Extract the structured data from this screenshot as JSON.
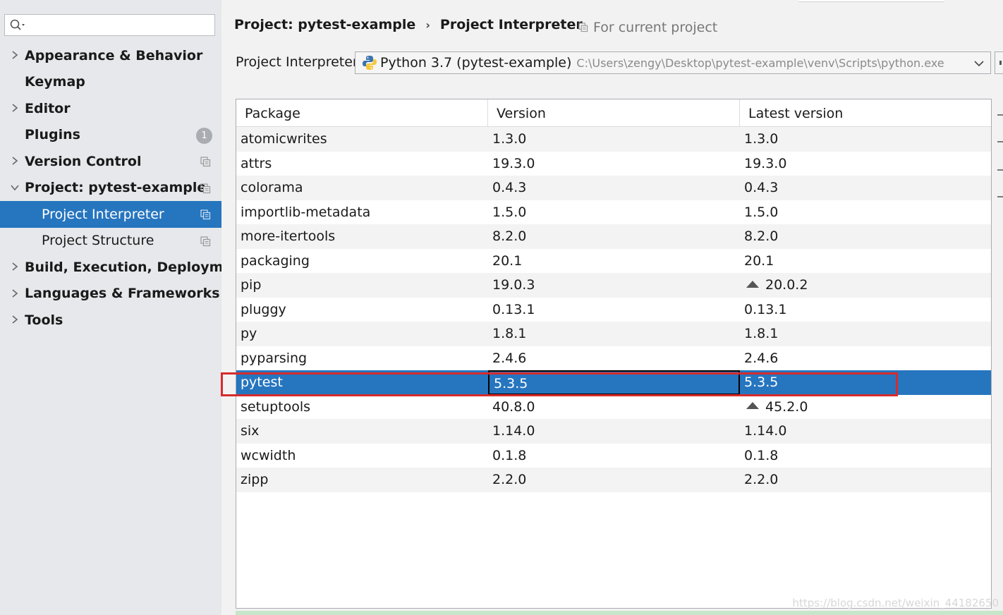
{
  "search": {
    "placeholder": ""
  },
  "sidebar": {
    "items": [
      {
        "label": "Appearance & Behavior",
        "expandable": true,
        "expanded": false
      },
      {
        "label": "Keymap",
        "expandable": false
      },
      {
        "label": "Editor",
        "expandable": true,
        "expanded": false
      },
      {
        "label": "Plugins",
        "expandable": false,
        "badge": "1"
      },
      {
        "label": "Version Control",
        "expandable": true,
        "expanded": false
      },
      {
        "label": "Project: pytest-example",
        "expandable": true,
        "expanded": true
      },
      {
        "label": "Project Interpreter",
        "child": true,
        "selected": true
      },
      {
        "label": "Project Structure",
        "child": true
      },
      {
        "label": "Build, Execution, Deployment",
        "expandable": true,
        "expanded": false
      },
      {
        "label": "Languages & Frameworks",
        "expandable": true,
        "expanded": false
      },
      {
        "label": "Tools",
        "expandable": true,
        "expanded": false
      }
    ]
  },
  "header": {
    "breadcrumb_parent": "Project: pytest-example",
    "breadcrumb_current": "Project Interpreter",
    "scope_label": "For current project"
  },
  "interpreter": {
    "label": "Project Interpreter:",
    "name": "Python 3.7 (pytest-example)",
    "path": "C:\\Users\\zengy\\Desktop\\pytest-example\\venv\\Scripts\\python.exe"
  },
  "table": {
    "columns": [
      "Package",
      "Version",
      "Latest version"
    ],
    "rows": [
      {
        "package": "atomicwrites",
        "version": "1.3.0",
        "latest": "1.3.0",
        "upgrade": false
      },
      {
        "package": "attrs",
        "version": "19.3.0",
        "latest": "19.3.0",
        "upgrade": false
      },
      {
        "package": "colorama",
        "version": "0.4.3",
        "latest": "0.4.3",
        "upgrade": false
      },
      {
        "package": "importlib-metadata",
        "version": "1.5.0",
        "latest": "1.5.0",
        "upgrade": false
      },
      {
        "package": "more-itertools",
        "version": "8.2.0",
        "latest": "8.2.0",
        "upgrade": false
      },
      {
        "package": "packaging",
        "version": "20.1",
        "latest": "20.1",
        "upgrade": false
      },
      {
        "package": "pip",
        "version": "19.0.3",
        "latest": "20.0.2",
        "upgrade": true
      },
      {
        "package": "pluggy",
        "version": "0.13.1",
        "latest": "0.13.1",
        "upgrade": false
      },
      {
        "package": "py",
        "version": "1.8.1",
        "latest": "1.8.1",
        "upgrade": false
      },
      {
        "package": "pyparsing",
        "version": "2.4.6",
        "latest": "2.4.6",
        "upgrade": false
      },
      {
        "package": "pytest",
        "version": "5.3.5",
        "latest": "5.3.5",
        "upgrade": false,
        "selected": true
      },
      {
        "package": "setuptools",
        "version": "40.8.0",
        "latest": "45.2.0",
        "upgrade": true
      },
      {
        "package": "six",
        "version": "1.14.0",
        "latest": "1.14.0",
        "upgrade": false
      },
      {
        "package": "wcwidth",
        "version": "0.1.8",
        "latest": "0.1.8",
        "upgrade": false
      },
      {
        "package": "zipp",
        "version": "2.2.0",
        "latest": "2.2.0",
        "upgrade": false
      }
    ]
  },
  "watermark": "https://blog.csdn.net/weixin_44182650",
  "colors": {
    "selection": "#2675bf",
    "highlight": "#d62c2c",
    "sidebar_bg": "#e6e8eb"
  }
}
